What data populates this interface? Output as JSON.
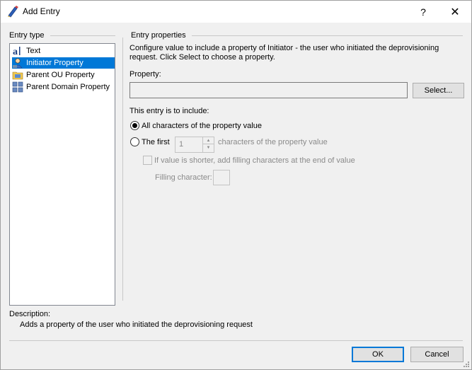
{
  "window": {
    "title": "Add Entry",
    "help_glyph": "?",
    "close_glyph": "✕"
  },
  "entry_type": {
    "label": "Entry type",
    "items": [
      {
        "label": "Text",
        "icon": "text-icon",
        "selected": false
      },
      {
        "label": "Initiator Property",
        "icon": "user-icon",
        "selected": true
      },
      {
        "label": "Parent OU Property",
        "icon": "ou-icon",
        "selected": false
      },
      {
        "label": "Parent Domain Property",
        "icon": "domain-icon",
        "selected": false
      }
    ]
  },
  "entry_properties": {
    "label": "Entry properties",
    "intro": "Configure value to include a property of Initiator - the user who initiated the deprovisioning",
    "intro2": "request. Click Select to choose a property.",
    "property_label": "Property:",
    "property_value": "",
    "select_button": "Select...",
    "include_label": "This entry is to include:",
    "option_all": "All characters of the property value",
    "option_first": "The first",
    "first_count": "1",
    "first_suffix": "characters of the property value",
    "shorter_checkbox": "If value is shorter, add filling characters at the end of value",
    "filling_label": "Filling character:"
  },
  "description": {
    "label": "Description:",
    "text": "Adds a property of the user who initiated the deprovisioning request"
  },
  "buttons": {
    "ok": "OK",
    "cancel": "Cancel"
  },
  "colors": {
    "selection": "#0078d7",
    "background": "#f0f0f0"
  }
}
